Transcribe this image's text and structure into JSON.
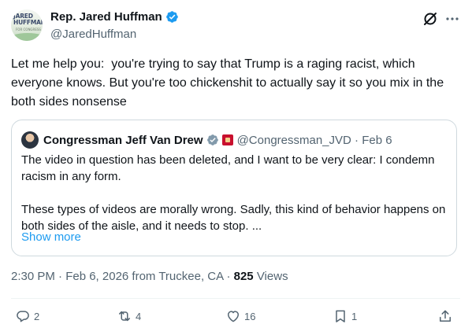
{
  "author": {
    "display_name": "Rep. Jared Huffman",
    "handle": "@JaredHuffman",
    "avatar_text": "JARED\nHUFFMAN",
    "avatar_sub": "FOR CONGRESS"
  },
  "tweet": {
    "text": "Let me help you:  you're trying to say that Trump is a raging racist, which everyone knows. But you're too chickenshit to actually say it so you mix in the both sides nonsense"
  },
  "quote": {
    "display_name": "Congressman Jeff Van Drew",
    "handle_date": "@Congressman_JVD · Feb 6",
    "paragraph_1": "The video in question has been deleted, and I want to be very clear: I condemn racism in any form.",
    "paragraph_2": "These types of videos are morally wrong. Sadly, this kind of behavior happens on both sides of the aisle, and it needs to stop. ...",
    "show_more": "Show more"
  },
  "meta": {
    "timestamp_location": "2:30 PM · Feb 6, 2026 from Truckee, CA · ",
    "views_count": "825",
    "views_label": " Views"
  },
  "actions": {
    "replies": "2",
    "reposts": "4",
    "likes": "16",
    "bookmarks": "1"
  },
  "colors": {
    "accent": "#1d9bf0",
    "text_secondary": "#536471",
    "border": "#cfd9de",
    "verified_gray": "#829aab"
  },
  "icons": {
    "verified": "verified-badge-icon",
    "grok": "grok-icon",
    "more": "more-icon",
    "reply": "reply-icon",
    "repost": "repost-icon",
    "like": "heart-icon",
    "bookmark": "bookmark-icon",
    "share": "share-icon"
  }
}
